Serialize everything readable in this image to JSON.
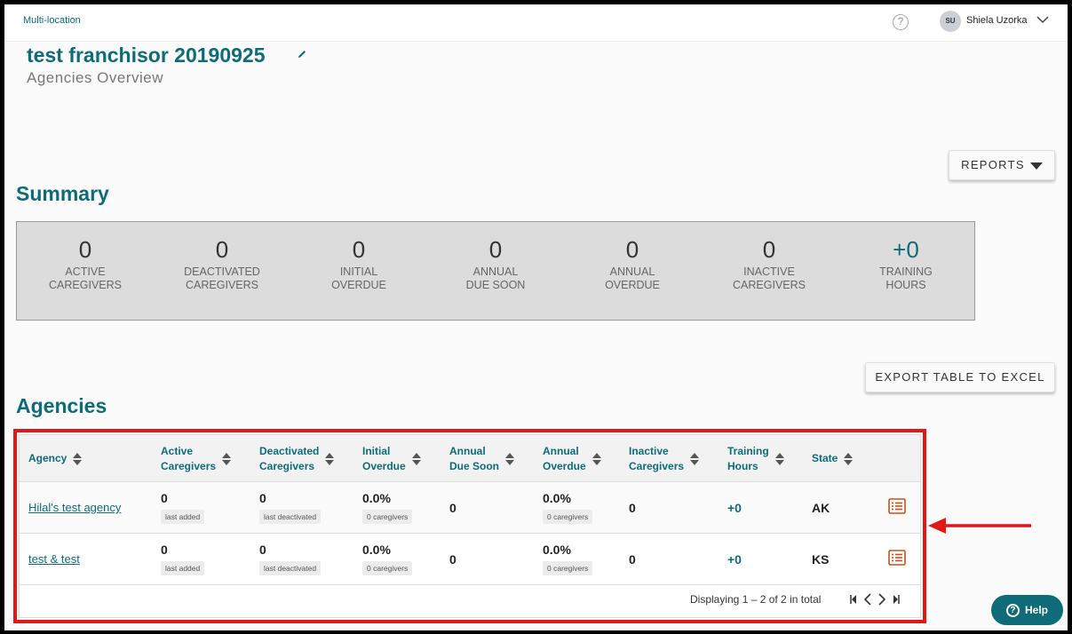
{
  "topbar": {
    "brand": "Multi-location",
    "help_glyph": "?",
    "user_initials": "SU",
    "user_name": "Shiela Uzorka"
  },
  "header": {
    "title": "test franchisor 20190925",
    "subtitle": "Agencies Overview"
  },
  "buttons": {
    "reports": "REPORTS",
    "export": "EXPORT TABLE TO EXCEL",
    "help": "Help"
  },
  "summary": {
    "heading": "Summary",
    "stats": [
      {
        "value": "0",
        "line1": "ACTIVE",
        "line2": "CAREGIVERS"
      },
      {
        "value": "0",
        "line1": "DEACTIVATED",
        "line2": "CAREGIVERS"
      },
      {
        "value": "0",
        "line1": "INITIAL",
        "line2": "OVERDUE"
      },
      {
        "value": "0",
        "line1": "ANNUAL",
        "line2": "DUE SOON"
      },
      {
        "value": "0",
        "line1": "ANNUAL",
        "line2": "OVERDUE"
      },
      {
        "value": "0",
        "line1": "INACTIVE",
        "line2": "CAREGIVERS"
      },
      {
        "value": "+0",
        "line1": "TRAINING",
        "line2": "HOURS"
      }
    ]
  },
  "agencies": {
    "heading": "Agencies",
    "columns": [
      {
        "line1": "Agency",
        "line2": ""
      },
      {
        "line1": "Active",
        "line2": "Caregivers"
      },
      {
        "line1": "Deactivated",
        "line2": "Caregivers"
      },
      {
        "line1": "Initial",
        "line2": "Overdue"
      },
      {
        "line1": "Annual",
        "line2": "Due Soon"
      },
      {
        "line1": "Annual",
        "line2": "Overdue"
      },
      {
        "line1": "Inactive",
        "line2": "Caregivers"
      },
      {
        "line1": "Training",
        "line2": "Hours"
      },
      {
        "line1": "State",
        "line2": ""
      }
    ],
    "rows": [
      {
        "agency": "Hilal's test agency",
        "active": "0",
        "active_tag": "last added",
        "deactivated": "0",
        "deactivated_tag": "last deactivated",
        "initial_overdue": "0.0%",
        "initial_tag": "0 caregivers",
        "annual_due_soon": "0",
        "annual_overdue": "0.0%",
        "annual_tag": "0 caregivers",
        "inactive": "0",
        "training_hours": "+0",
        "state": "AK"
      },
      {
        "agency": "test & test",
        "active": "0",
        "active_tag": "last added",
        "deactivated": "0",
        "deactivated_tag": "last deactivated",
        "initial_overdue": "0.0%",
        "initial_tag": "0 caregivers",
        "annual_due_soon": "0",
        "annual_overdue": "0.0%",
        "annual_tag": "0 caregivers",
        "inactive": "0",
        "training_hours": "+0",
        "state": "KS"
      }
    ],
    "pager_text": "Displaying 1 – 2 of 2 in total"
  },
  "colors": {
    "accent": "#0e6b77",
    "highlight": "#e01818",
    "row_icon": "#c8501e"
  },
  "icons": [
    "question-circle-icon",
    "chevron-down-icon",
    "pencil-icon",
    "caret-down-icon",
    "sort-icon",
    "list-icon",
    "first-page-icon",
    "prev-page-icon",
    "next-page-icon",
    "last-page-icon",
    "red-arrow-icon"
  ]
}
